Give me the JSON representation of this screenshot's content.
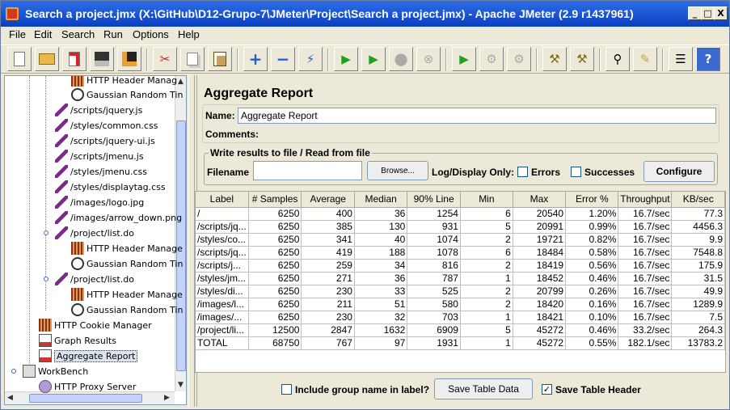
{
  "window": {
    "title": "Search a project.jmx (X:\\GitHub\\D12-Grupo-7\\JMeter\\Project\\Search a project.jmx) - Apache JMeter (2.9 r1437961)",
    "minimize": "_",
    "maximize": "□",
    "close": "X"
  },
  "menu": [
    "File",
    "Edit",
    "Search",
    "Run",
    "Options",
    "Help"
  ],
  "toolbar_icons": [
    "new-icon",
    "open-icon",
    "close-icon",
    "save-icon",
    "save-snapshot-icon",
    "cut-icon",
    "copy-icon",
    "paste-icon",
    "expand-icon",
    "collapse-icon",
    "toggle-icon",
    "start-icon",
    "start-no-pause-icon",
    "stop-icon",
    "shutdown-icon",
    "remote-start-icon",
    "remote-stop-icon",
    "remote-shutdown-icon",
    "clear-icon",
    "clear-all-icon",
    "search-icon",
    "reset-search-icon",
    "function-helper-icon",
    "help-icon"
  ],
  "tree": {
    "items": [
      {
        "label": "HTTP Header Manag",
        "icon": "config-icon",
        "kind": "cfg"
      },
      {
        "label": "Gaussian Random Tin",
        "icon": "timer-icon",
        "kind": "clock"
      },
      {
        "label": "/scripts/jquery.js",
        "icon": "sampler-icon",
        "kind": "pipe"
      },
      {
        "label": "/styles/common.css",
        "icon": "sampler-icon",
        "kind": "pipe"
      },
      {
        "label": "/scripts/jquery-ui.js",
        "icon": "sampler-icon",
        "kind": "pipe"
      },
      {
        "label": "/scripts/jmenu.js",
        "icon": "sampler-icon",
        "kind": "pipe"
      },
      {
        "label": "/styles/jmenu.css",
        "icon": "sampler-icon",
        "kind": "pipe"
      },
      {
        "label": "/styles/displaytag.css",
        "icon": "sampler-icon",
        "kind": "pipe"
      },
      {
        "label": "/images/logo.jpg",
        "icon": "sampler-icon",
        "kind": "pipe"
      },
      {
        "label": "/images/arrow_down.png",
        "icon": "sampler-icon",
        "kind": "pipe"
      },
      {
        "label": "/project/list.do",
        "icon": "sampler-icon",
        "kind": "pipe"
      },
      {
        "label": "HTTP Header Manage",
        "icon": "config-icon",
        "kind": "cfg"
      },
      {
        "label": "Gaussian Random Tin",
        "icon": "timer-icon",
        "kind": "clock"
      },
      {
        "label": "/project/list.do",
        "icon": "sampler-icon",
        "kind": "pipe"
      },
      {
        "label": "HTTP Header Manage",
        "icon": "config-icon",
        "kind": "cfg"
      },
      {
        "label": "Gaussian Random Tin",
        "icon": "timer-icon",
        "kind": "clock"
      },
      {
        "label": "HTTP Cookie Manager",
        "icon": "config-icon",
        "kind": "cfg"
      },
      {
        "label": "Graph Results",
        "icon": "graph-icon",
        "kind": "graph"
      },
      {
        "label": "Aggregate Report",
        "icon": "graph-icon",
        "kind": "graph",
        "selected": true
      },
      {
        "label": "WorkBench",
        "icon": "workbench-icon",
        "kind": "wb"
      },
      {
        "label": "HTTP Proxy Server",
        "icon": "proxy-icon",
        "kind": "proxy"
      }
    ]
  },
  "panel": {
    "title": "Aggregate Report",
    "name_label": "Name:",
    "name_value": "Aggregate Report",
    "comments_label": "Comments:",
    "file_group_title": "Write results to file / Read from file",
    "filename_label": "Filename",
    "filename_value": "",
    "browse_label": "Browse...",
    "log_only_label": "Log/Display Only:",
    "errors_label": "Errors",
    "successes_label": "Successes",
    "configure_label": "Configure"
  },
  "table": {
    "headers": [
      "Label",
      "# Samples",
      "Average",
      "Median",
      "90% Line",
      "Min",
      "Max",
      "Error %",
      "Throughput",
      "KB/sec"
    ],
    "rows": [
      [
        "/",
        "6250",
        "400",
        "36",
        "1254",
        "6",
        "20540",
        "1.20%",
        "16.7/sec",
        "77.3"
      ],
      [
        "/scripts/jq...",
        "6250",
        "385",
        "130",
        "931",
        "5",
        "20991",
        "0.99%",
        "16.7/sec",
        "4456.3"
      ],
      [
        "/styles/co...",
        "6250",
        "341",
        "40",
        "1074",
        "2",
        "19721",
        "0.82%",
        "16.7/sec",
        "9.9"
      ],
      [
        "/scripts/jq...",
        "6250",
        "419",
        "188",
        "1078",
        "6",
        "18484",
        "0.58%",
        "16.7/sec",
        "7548.8"
      ],
      [
        "/scripts/j...",
        "6250",
        "259",
        "34",
        "816",
        "2",
        "18419",
        "0.56%",
        "16.7/sec",
        "175.9"
      ],
      [
        "/styles/jm...",
        "6250",
        "271",
        "36",
        "787",
        "1",
        "18452",
        "0.46%",
        "16.7/sec",
        "31.5"
      ],
      [
        "/styles/di...",
        "6250",
        "230",
        "33",
        "525",
        "2",
        "20799",
        "0.26%",
        "16.7/sec",
        "49.9"
      ],
      [
        "/images/l...",
        "6250",
        "211",
        "51",
        "580",
        "2",
        "18420",
        "0.16%",
        "16.7/sec",
        "1289.9"
      ],
      [
        "/images/...",
        "6250",
        "230",
        "32",
        "703",
        "1",
        "18421",
        "0.10%",
        "16.7/sec",
        "7.5"
      ],
      [
        "/project/li...",
        "12500",
        "2847",
        "1632",
        "6909",
        "5",
        "45272",
        "0.46%",
        "33.2/sec",
        "264.3"
      ],
      [
        "TOTAL",
        "68750",
        "767",
        "97",
        "1931",
        "1",
        "45272",
        "0.55%",
        "182.1/sec",
        "13783.2"
      ]
    ]
  },
  "footer": {
    "include_group_label": "Include group name in label?",
    "include_group_checked": false,
    "save_table_data_label": "Save Table Data",
    "save_table_header_label": "Save Table Header",
    "save_table_header_checked": true
  }
}
